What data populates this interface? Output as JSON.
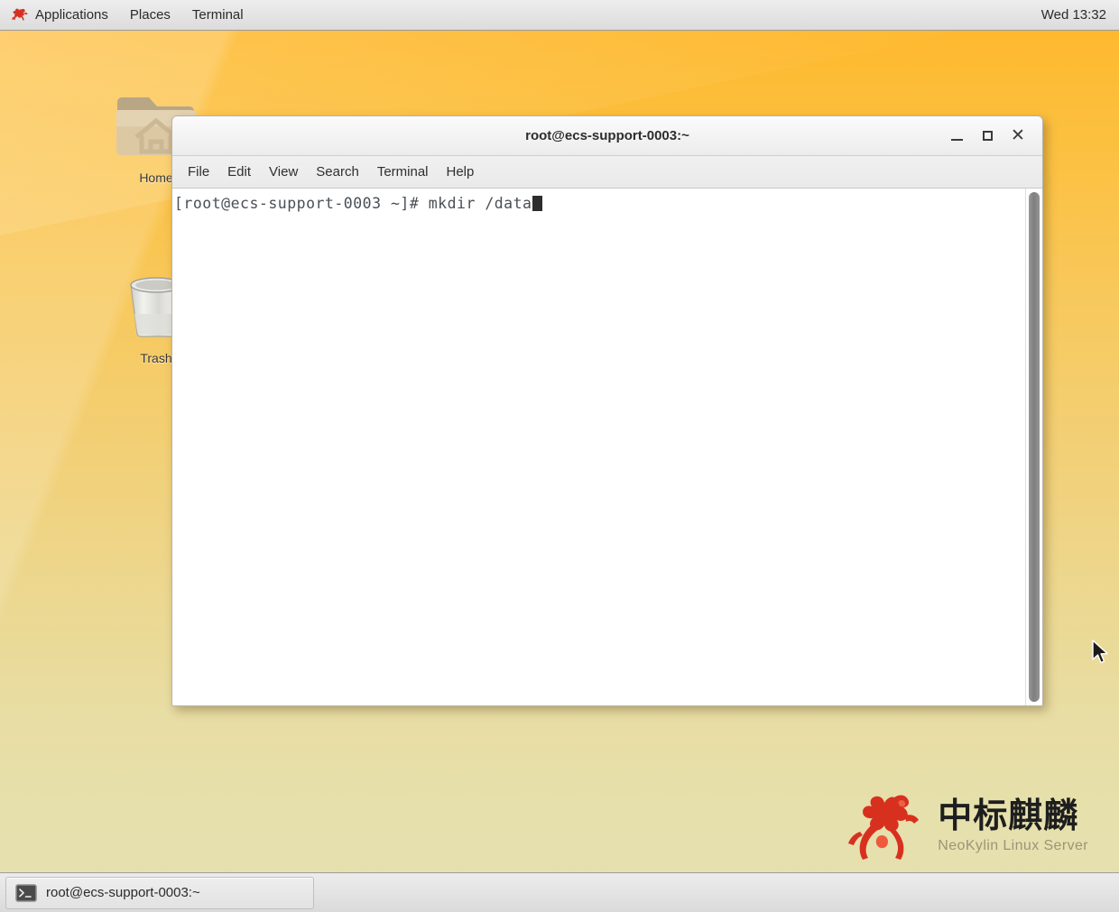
{
  "top_panel": {
    "logo_icon": "kylin-logo-icon",
    "menus": [
      {
        "label": "Applications"
      },
      {
        "label": "Places"
      },
      {
        "label": "Terminal"
      }
    ],
    "clock": "Wed 13:32"
  },
  "desktop": {
    "background_colors": {
      "top": "#ffb629",
      "bottom": "#e5e1b0"
    },
    "icons": [
      {
        "name": "home-folder",
        "label": "Home",
        "icon": "home-folder-icon"
      },
      {
        "name": "trash",
        "label": "Trash",
        "icon": "trash-bin-icon"
      }
    ]
  },
  "terminal_window": {
    "title": "root@ecs-support-0003:~",
    "controls": {
      "minimize": "minimize-icon",
      "maximize": "maximize-icon",
      "close": "close-icon"
    },
    "menubar": [
      {
        "label": "File"
      },
      {
        "label": "Edit"
      },
      {
        "label": "View"
      },
      {
        "label": "Search"
      },
      {
        "label": "Terminal"
      },
      {
        "label": "Help"
      }
    ],
    "content": {
      "prompt": "[root@ecs-support-0003 ~]# ",
      "command": "mkdir /data",
      "line": "[root@ecs-support-0003 ~]# mkdir /data",
      "cursor": "block"
    },
    "text_color": "#4a4f55",
    "background_color": "#ffffff"
  },
  "branding": {
    "chinese_name": "中标麒麟",
    "english_name": "NeoKylin Linux Server",
    "mascot_color": "#d8301f"
  },
  "taskbar": {
    "buttons": [
      {
        "label": "root@ecs-support-0003:~",
        "icon": "terminal-icon"
      }
    ]
  }
}
